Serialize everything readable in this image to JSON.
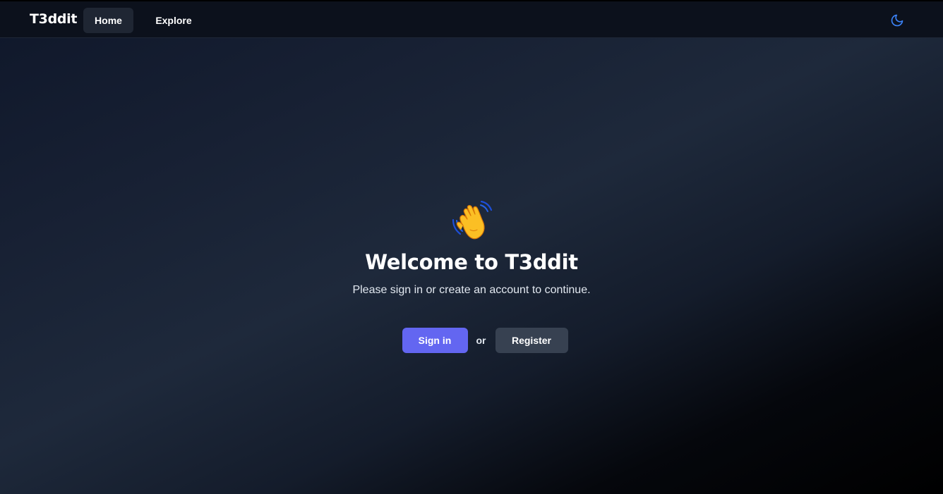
{
  "navbar": {
    "brand": "T3ddit",
    "items": [
      {
        "label": "Home",
        "active": true
      },
      {
        "label": "Explore",
        "active": false
      }
    ],
    "theme_icon": "moon-icon"
  },
  "hero": {
    "icon": "waving-hand-icon",
    "title": "Welcome to T3ddit",
    "subtitle": "Please sign in or create an account to continue."
  },
  "actions": {
    "signin_label": "Sign in",
    "or_label": "or",
    "register_label": "Register"
  },
  "colors": {
    "accent": "#6366f1",
    "secondary_button": "#374151",
    "theme_icon": "#3b82f6",
    "nav_active_bg": "#1f2633"
  }
}
